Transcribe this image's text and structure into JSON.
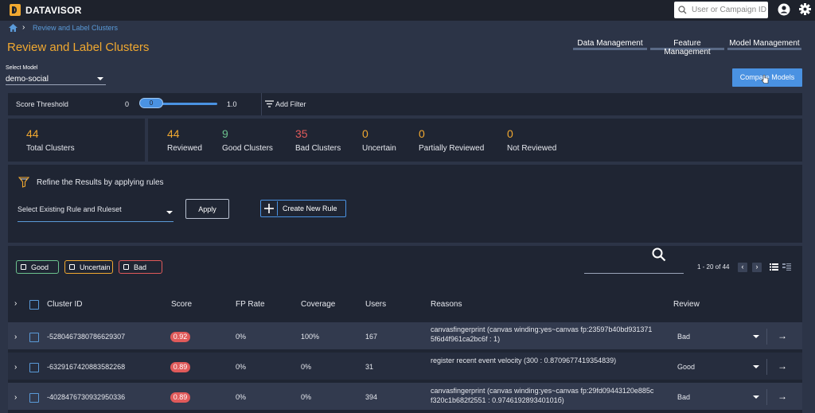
{
  "app": {
    "name": "DATAVISOR"
  },
  "header": {
    "search_placeholder": "User or Campaign ID"
  },
  "breadcrumb": {
    "item": "Review and Label Clusters"
  },
  "page": {
    "title": "Review and Label Clusters"
  },
  "nav": {
    "data_management": "Data Management",
    "feature_management": "Feature Management",
    "model_management": "Model Management"
  },
  "model_select": {
    "label": "Select Model",
    "value": "demo-social"
  },
  "compare_button": "Compare Models",
  "score": {
    "label": "Score Threshold",
    "min": "0",
    "value": "0",
    "max": "1.0",
    "add_filter": "Add Filter"
  },
  "stats": {
    "total": {
      "value": "44",
      "label": "Total Clusters"
    },
    "reviewed": {
      "value": "44",
      "label": "Reviewed"
    },
    "good": {
      "value": "9",
      "label": "Good Clusters"
    },
    "bad": {
      "value": "35",
      "label": "Bad Clusters"
    },
    "uncertain": {
      "value": "0",
      "label": "Uncertain"
    },
    "partial": {
      "value": "0",
      "label": "Partially Reviewed"
    },
    "not_reviewed": {
      "value": "0",
      "label": "Not Reviewed"
    }
  },
  "rules": {
    "heading": "Refine the Results by applying rules",
    "select_placeholder": "Select Existing Rule and Ruleset",
    "apply": "Apply",
    "create": "Create New Rule"
  },
  "tags": {
    "good": "Good",
    "uncertain": "Uncertain",
    "bad": "Bad"
  },
  "pagination": {
    "range": "1 - 20 of 44"
  },
  "table": {
    "headers": {
      "id": "Cluster ID",
      "score": "Score",
      "fp": "FP Rate",
      "coverage": "Coverage",
      "users": "Users",
      "reasons": "Reasons",
      "review": "Review"
    },
    "rows": [
      {
        "id": "-5280467380786629307",
        "score": "0.92",
        "fp": "0%",
        "coverage": "100%",
        "users": "167",
        "reason1": "canvasfingerprint (canvas winding:yes~canvas fp:23597b40bd931371",
        "reason2": "5f6d4f961ca2bc6f : 1)",
        "review": "Bad"
      },
      {
        "id": "-6329167420883582268",
        "score": "0.89",
        "fp": "0%",
        "coverage": "0%",
        "users": "31",
        "reason1": "register recent event velocity (300 : 0.8709677419354839)",
        "reason2": "",
        "review": "Good"
      },
      {
        "id": "-4028476730932950336",
        "score": "0.89",
        "fp": "0%",
        "coverage": "0%",
        "users": "394",
        "reason1": "canvasfingerprint (canvas winding:yes~canvas fp:29fd09443120e885c",
        "reason2": "f320c1b682f2551 : 0.974619289340101б)",
        "review": "Bad"
      }
    ]
  },
  "colors": {
    "accent": "#f0a830",
    "primary": "#4a92e2",
    "good": "#6cc28e",
    "bad": "#e05a5a",
    "panel": "#1f2533"
  }
}
